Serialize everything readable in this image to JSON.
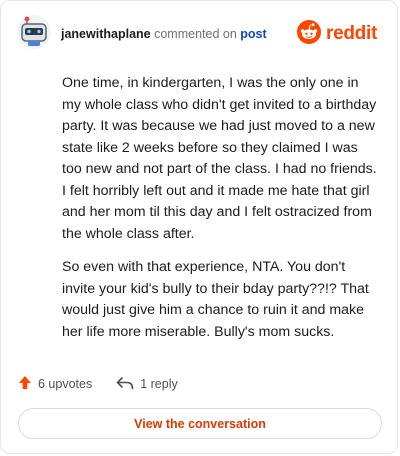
{
  "comment": {
    "username": "janewithaplane",
    "action": "commented on",
    "target": "post",
    "paragraphs": [
      "One time, in kindergarten, I was the only one in my whole class who didn't get invited to a birthday party. It was because we had just moved to a new state like 2 weeks before so they claimed I was too new and not part of the class. I had no friends. I felt horribly left out and it made me hate that girl and her mom til this day and I felt ostracized from the whole class after.",
      "So even with that experience, NTA. You don't invite your kid's bully to their bday party??!? That would just give him a chance to ruin it and make her life more miserable. Bully's mom sucks."
    ],
    "upvotes": "6 upvotes",
    "replies": "1 reply"
  },
  "brand": {
    "name": "reddit",
    "color": "#ff4500"
  },
  "actions": {
    "view_conversation": "View the conversation"
  },
  "icons": {
    "avatar": "robot-avatar-icon",
    "logo": "reddit-alien-icon",
    "upvote": "upvote-arrow-icon",
    "reply": "reply-arrow-icon"
  }
}
